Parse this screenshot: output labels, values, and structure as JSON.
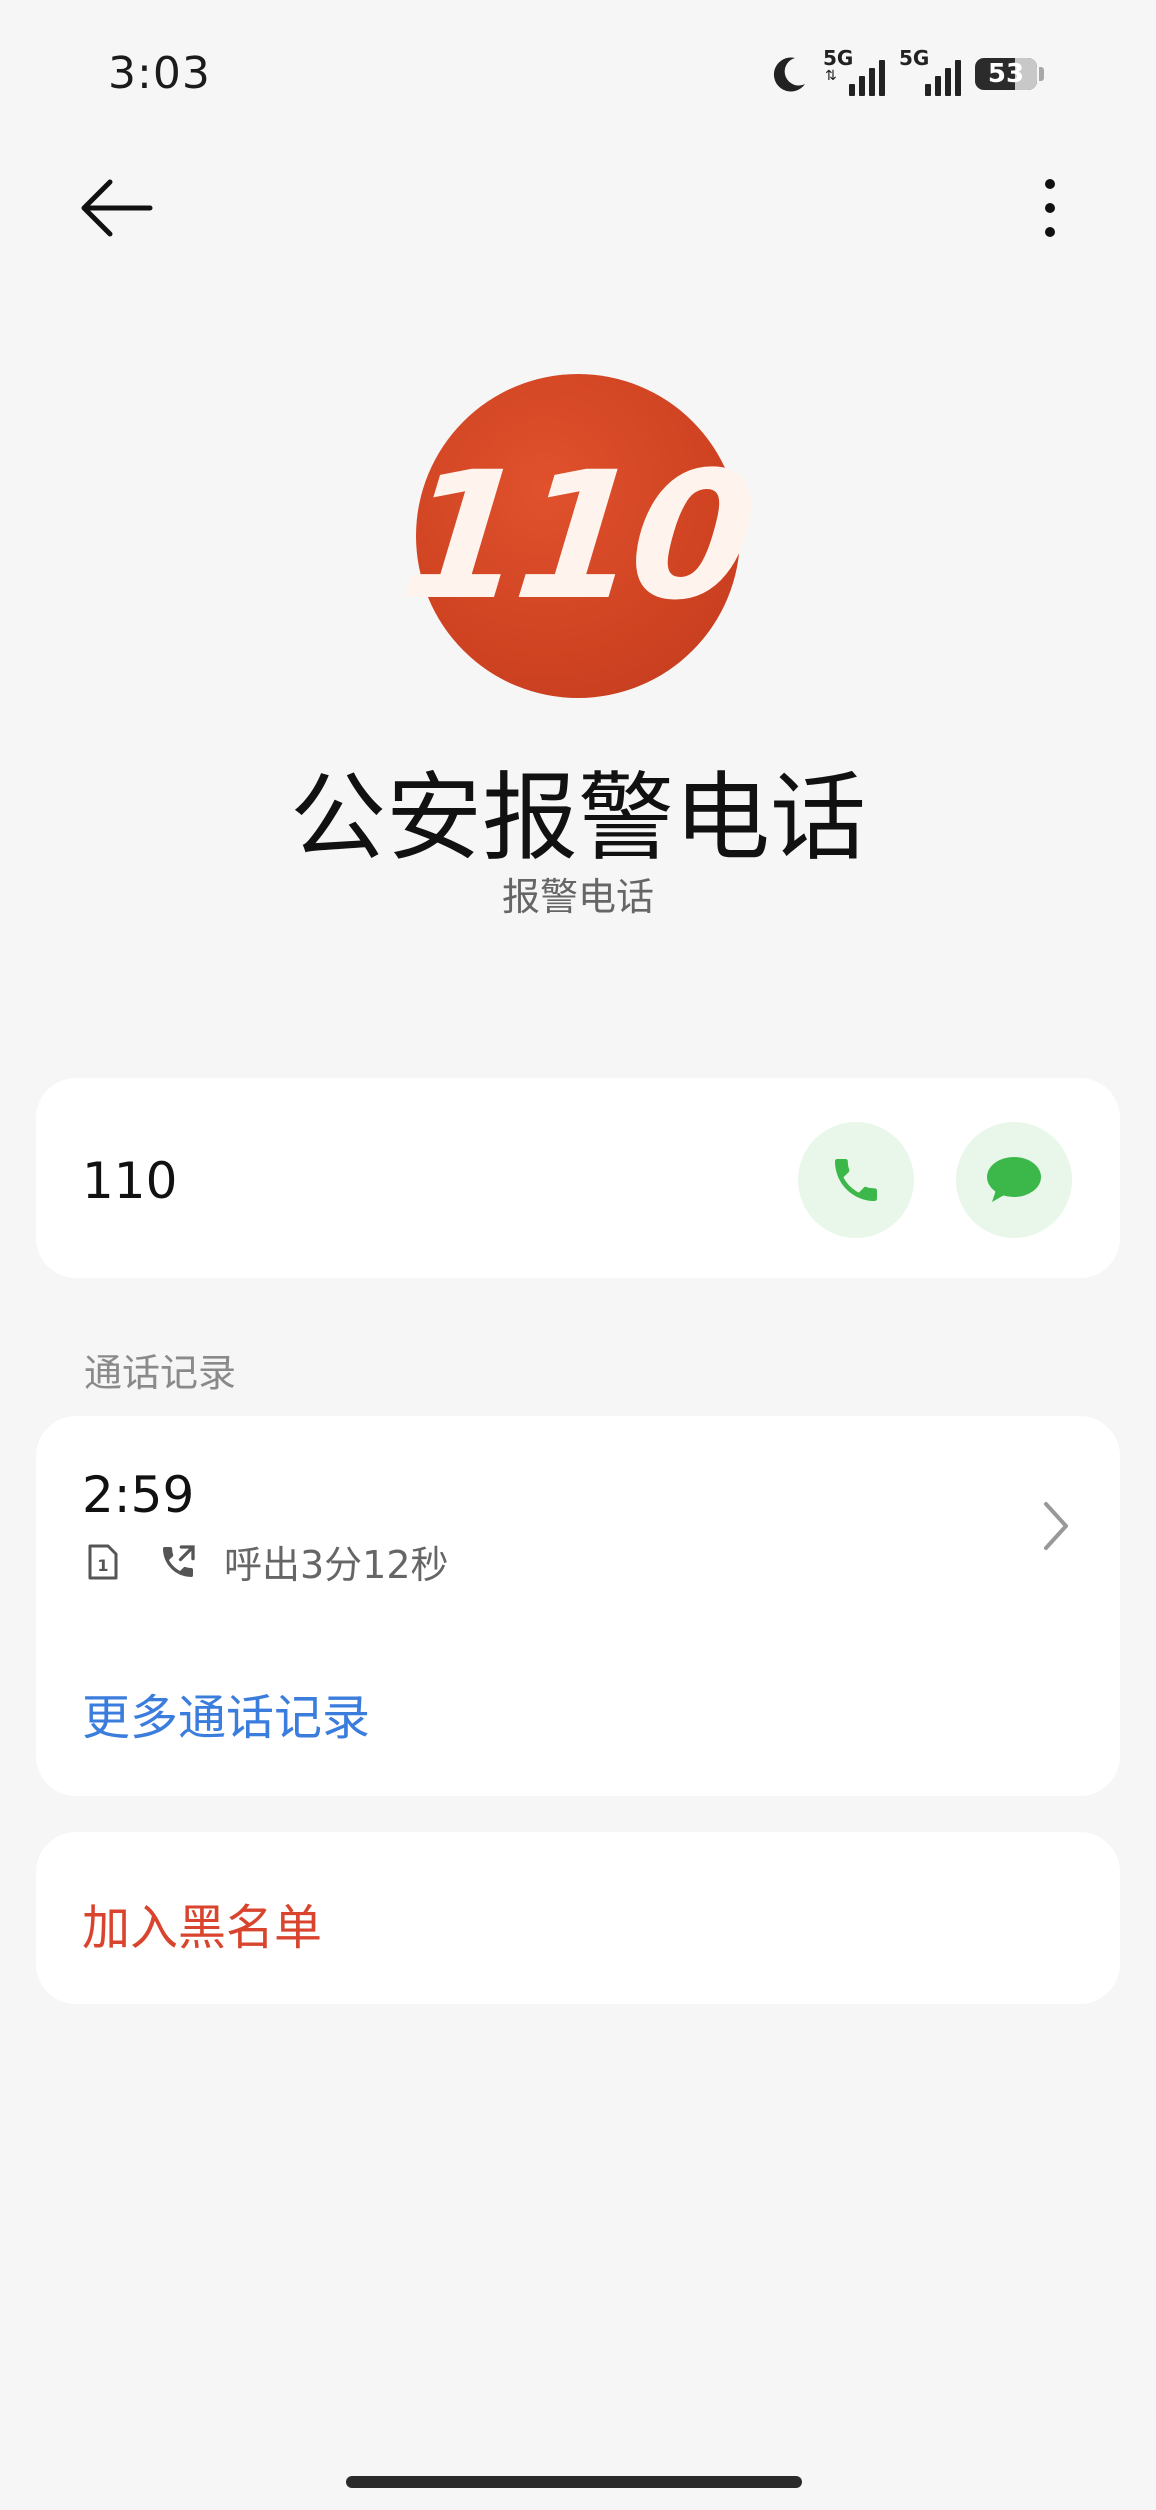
{
  "status_bar": {
    "time": "3:03",
    "network1": "5G",
    "network2": "5G",
    "battery": "53"
  },
  "contact": {
    "avatar_text": "110",
    "name": "公安报警电话",
    "subtitle": "报警电话",
    "number": "110"
  },
  "call_history": {
    "section_label": "通话记录",
    "entries": [
      {
        "time": "2:59",
        "description": "呼出3分12秒"
      }
    ],
    "more_link": "更多通话记录"
  },
  "actions": {
    "block": "加入黑名单"
  },
  "colors": {
    "accent_green": "#3cb84a",
    "button_bg_green": "#e8f7ea",
    "link_blue": "#3b7ddd",
    "danger_red": "#d9442e",
    "avatar_red": "#cf4322"
  },
  "icons": {
    "back": "arrow-left-icon",
    "more": "more-vertical-icon",
    "call": "phone-icon",
    "message": "message-icon",
    "sim": "sim-card-icon",
    "outgoing": "outgoing-call-icon",
    "chevron": "chevron-right-icon"
  }
}
